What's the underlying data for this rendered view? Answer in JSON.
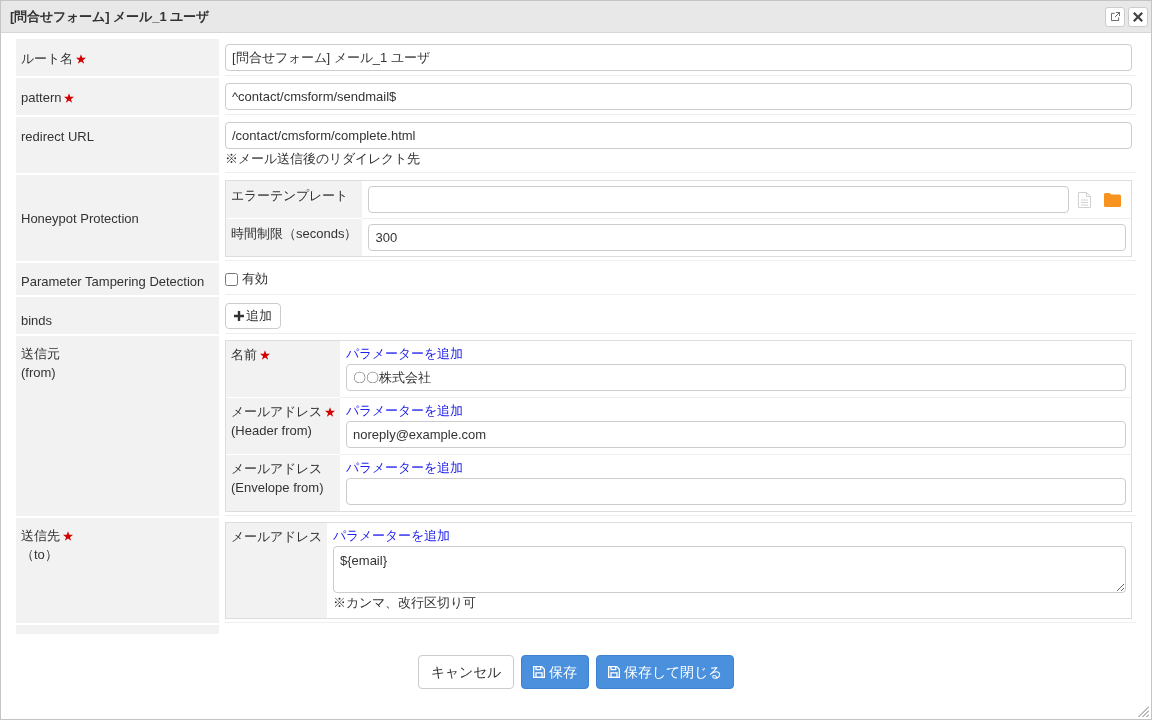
{
  "window": {
    "title": "[問合せフォーム] メール_1 ユーザ"
  },
  "form": {
    "rows": [
      {
        "kind": "text",
        "label": "ルート名",
        "required": true,
        "value": "[問合せフォーム] メール_1 ユーザ"
      },
      {
        "kind": "text",
        "label": "pattern",
        "required": true,
        "value": "^contact/cmsform/sendmail$"
      },
      {
        "kind": "text",
        "label": "redirect URL",
        "required": false,
        "value": "/contact/cmsform/complete.html",
        "note": "※メール送信後のリダイレクト先"
      },
      {
        "kind": "settings",
        "label": "Honeypot Protection",
        "required": false,
        "fields": [
          {
            "kind": "file",
            "label": "エラーテンプレート"
          },
          {
            "kind": "text",
            "label": "時間制限（seconds）",
            "value": "300"
          }
        ]
      },
      {
        "kind": "checkbox",
        "label": "Parameter Tampering Detection",
        "required": false,
        "option": "有効",
        "checked": false
      },
      {
        "kind": "add",
        "label": "binds",
        "required": false,
        "button": "追加"
      },
      {
        "kind": "params",
        "label": "送信元",
        "sublabel": "(from)",
        "required": false,
        "fields": [
          {
            "kind": "text",
            "label": "名前",
            "required": true,
            "link": "パラメーターを追加",
            "value": "〇〇株式会社"
          },
          {
            "kind": "text",
            "label": "メールアドレス",
            "sublabel": "(Header from)",
            "required": true,
            "link": "パラメーターを追加",
            "value": "noreply@example.com"
          },
          {
            "kind": "text",
            "label": "メールアドレス",
            "sublabel": "(Envelope from)",
            "required": false,
            "link": "パラメーターを追加"
          }
        ]
      },
      {
        "kind": "params",
        "label": "送信先",
        "sublabel": "（to）",
        "required": true,
        "fields": [
          {
            "kind": "textarea",
            "label": "メールアドレス",
            "required": false,
            "link": "パラメーターを追加",
            "value": "${email}",
            "note": "※カンマ、改行区切り可"
          }
        ]
      }
    ]
  },
  "buttons": [
    {
      "kind": "default",
      "label": "キャンセル"
    },
    {
      "kind": "primary",
      "label": "保存"
    },
    {
      "kind": "primary",
      "label": "保存して閉じる"
    }
  ]
}
